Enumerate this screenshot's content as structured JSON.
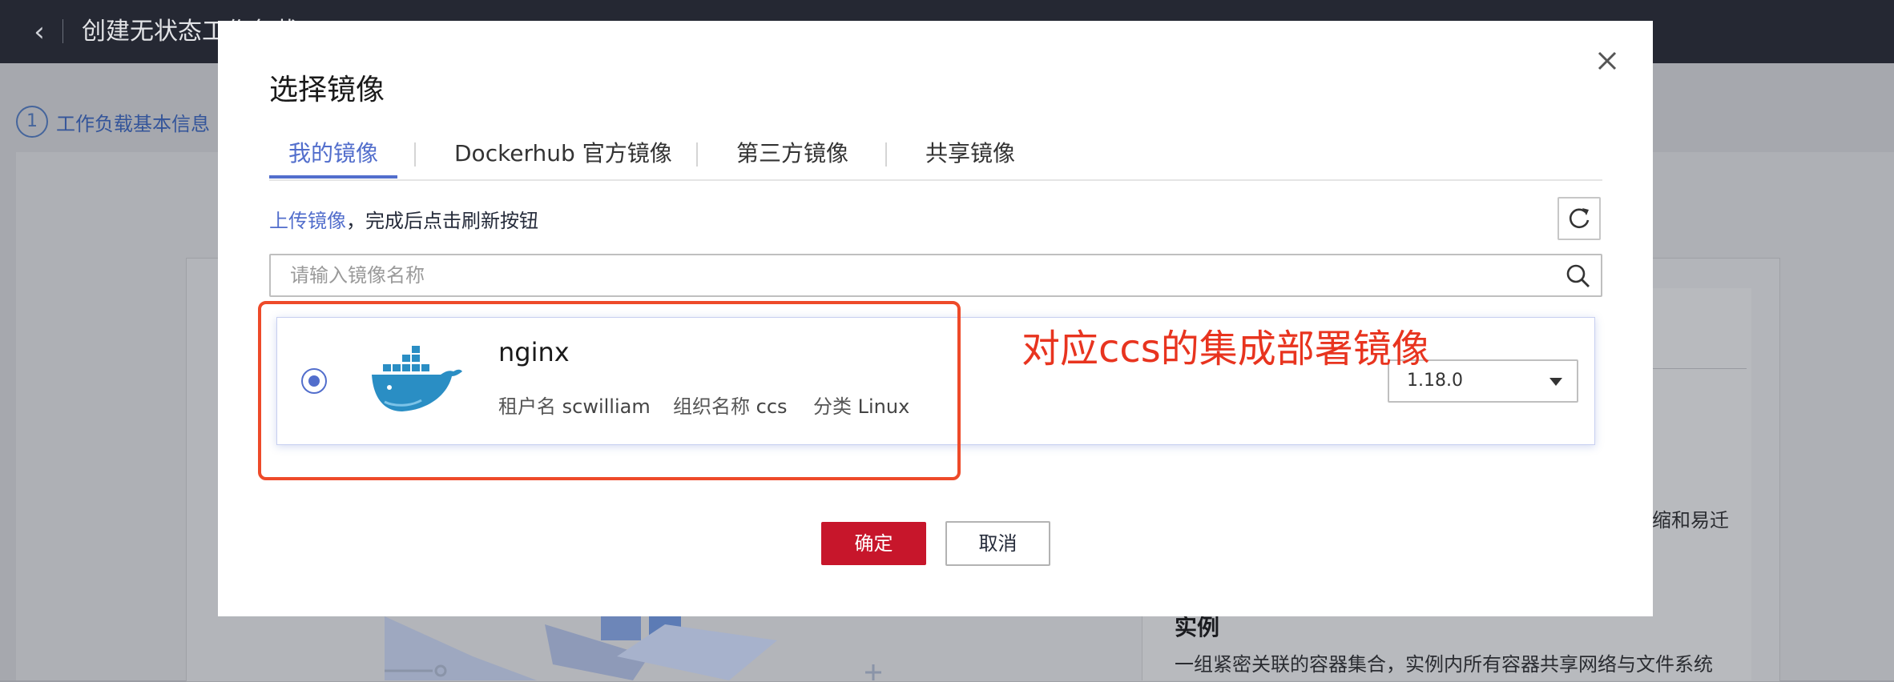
{
  "background": {
    "page_title": "创建无状态工作负载",
    "step_number": "1",
    "step_label": "工作负载基本信息",
    "side_text_1": "缩和易迁",
    "section_heading": "实例",
    "section_desc": "一组紧密关联的容器集合，实例内所有容器共享网络与文件系统"
  },
  "modal": {
    "title": "选择镜像",
    "tabs": [
      {
        "label": "我的镜像",
        "active": true
      },
      {
        "label": "Dockerhub 官方镜像",
        "active": false
      },
      {
        "label": "第三方镜像",
        "active": false
      },
      {
        "label": "共享镜像",
        "active": false
      }
    ],
    "upload_link": "上传镜像",
    "upload_hint": "，完成后点击刷新按钮",
    "search_placeholder": "请输入镜像名称",
    "image": {
      "name": "nginx",
      "tenant_label": "租户名",
      "tenant_value": "scwilliam",
      "org_label": "组织名称",
      "org_value": "ccs",
      "category_label": "分类",
      "category_value": "Linux",
      "version": "1.18.0",
      "selected": true
    },
    "confirm_label": "确定",
    "cancel_label": "取消"
  },
  "annotation": {
    "text": "对应ccs的集成部署镜像",
    "color": "#e8341f"
  },
  "colors": {
    "accent": "#526ecc",
    "primary_button": "#c7162b",
    "topbar": "#252833"
  }
}
